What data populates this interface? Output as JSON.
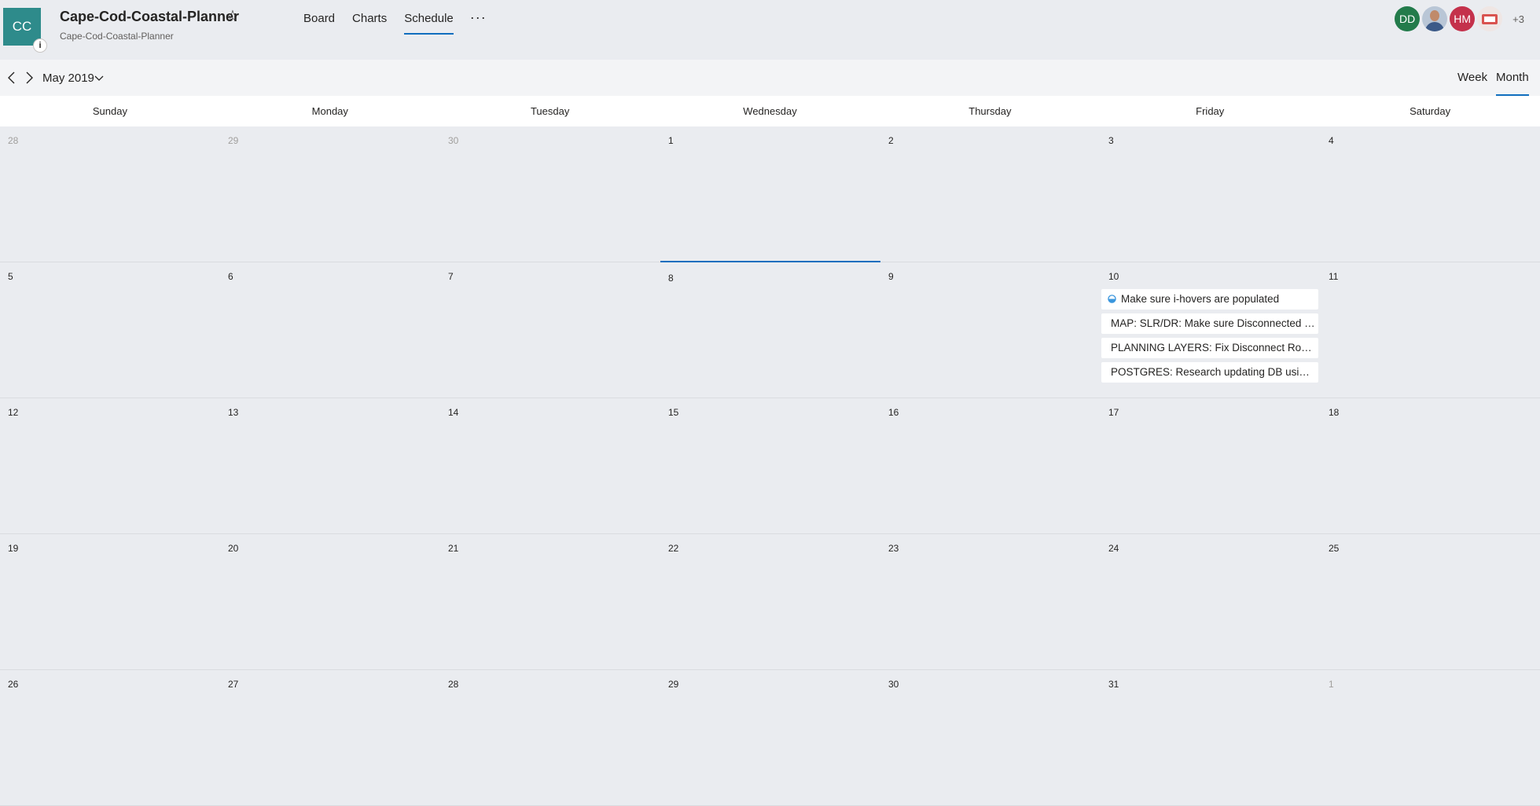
{
  "plan": {
    "initials": "CC",
    "info_glyph": "i",
    "title": "Cape-Cod-Coastal-Planner",
    "subtitle": "Cape-Cod-Coastal-Planner",
    "star_icon": "☆"
  },
  "nav": {
    "tabs": [
      {
        "label": "Board"
      },
      {
        "label": "Charts"
      },
      {
        "label": "Schedule",
        "active": true
      }
    ],
    "more_label": "···"
  },
  "members": {
    "avatars": [
      {
        "initials": "DD",
        "color": "#237b4b"
      },
      {
        "initials": "",
        "photo": true
      },
      {
        "initials": "HM",
        "color": "#c4314b"
      },
      {
        "initials": "",
        "photo": true
      }
    ],
    "overflow_label": "+3"
  },
  "toolbar": {
    "month_label": "May 2019",
    "views": [
      {
        "label": "Week"
      },
      {
        "label": "Month",
        "active": true
      }
    ]
  },
  "calendar": {
    "weekdays": [
      "Sunday",
      "Monday",
      "Tuesday",
      "Wednesday",
      "Thursday",
      "Friday",
      "Saturday"
    ],
    "weeks": [
      [
        {
          "d": "28",
          "muted": true
        },
        {
          "d": "29",
          "muted": true
        },
        {
          "d": "30",
          "muted": true
        },
        {
          "d": "1"
        },
        {
          "d": "2"
        },
        {
          "d": "3"
        },
        {
          "d": "4"
        }
      ],
      [
        {
          "d": "5"
        },
        {
          "d": "6"
        },
        {
          "d": "7"
        },
        {
          "d": "8",
          "today": true
        },
        {
          "d": "9"
        },
        {
          "d": "10"
        },
        {
          "d": "11"
        }
      ],
      [
        {
          "d": "12"
        },
        {
          "d": "13"
        },
        {
          "d": "14"
        },
        {
          "d": "15"
        },
        {
          "d": "16"
        },
        {
          "d": "17"
        },
        {
          "d": "18"
        }
      ],
      [
        {
          "d": "19"
        },
        {
          "d": "20"
        },
        {
          "d": "21"
        },
        {
          "d": "22"
        },
        {
          "d": "23"
        },
        {
          "d": "24"
        },
        {
          "d": "25"
        }
      ],
      [
        {
          "d": "26"
        },
        {
          "d": "27"
        },
        {
          "d": "28"
        },
        {
          "d": "29"
        },
        {
          "d": "30"
        },
        {
          "d": "31"
        },
        {
          "d": "1",
          "muted": true
        }
      ]
    ],
    "tasks_day": "10",
    "tasks": [
      {
        "title": "Make sure i-hovers are populated",
        "progress_icon": "half-circle-progress-icon"
      },
      {
        "title": "MAP: SLR/DR: Make sure Disconnected R..."
      },
      {
        "title": "PLANNING LAYERS: Fix Disconnect Road..."
      },
      {
        "title": "POSTGRES: Research updating DB using ..."
      }
    ]
  },
  "colors": {
    "accent": "#106ebe",
    "logo_bg": "#2e8b8b",
    "page_bg": "#eaecf0"
  }
}
